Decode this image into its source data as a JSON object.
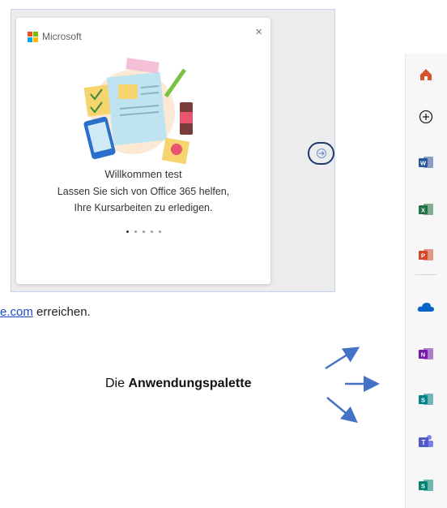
{
  "dialog": {
    "brand_name": "Microsoft",
    "close_glyph": "×",
    "title": "Willkommen test",
    "body": "Lassen Sie sich von Office 365 helfen, Ihre Kursarbeiten zu erledigen.",
    "carousel": {
      "total": 5,
      "active_index": 0
    },
    "next_button_icon": "arrow-right-icon"
  },
  "text": {
    "link_text": "e.com",
    "after_link": " erreichen.",
    "palette_label_prefix": "Die ",
    "palette_label_bold": "Anwendungspalette"
  },
  "sidebar": {
    "items": [
      {
        "name": "home-icon",
        "color": "#d6542c"
      },
      {
        "name": "create-icon",
        "color": "#222222"
      },
      {
        "name": "word-icon",
        "color": "#2b579a",
        "letter": "W"
      },
      {
        "name": "excel-icon",
        "color": "#217346",
        "letter": "X"
      },
      {
        "name": "powerpoint-icon",
        "color": "#d24726",
        "letter": "P"
      },
      {
        "name": "onedrive-icon",
        "color": "#0a64c8"
      },
      {
        "name": "onenote-icon",
        "color": "#7719aa",
        "letter": "N"
      },
      {
        "name": "sharepoint-icon",
        "color": "#038387",
        "letter": "S"
      },
      {
        "name": "teams-icon",
        "color": "#5059c9"
      },
      {
        "name": "sway-icon",
        "color": "#008272",
        "letter": "S"
      }
    ]
  },
  "colors": {
    "link": "#1a4fc4",
    "annotation_arrow": "#4472c4",
    "highlight_ring": "#1f3a6e"
  }
}
